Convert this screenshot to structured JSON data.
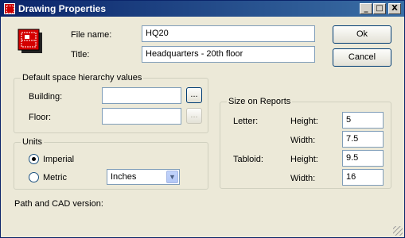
{
  "window": {
    "title": "Drawing Properties"
  },
  "titlebar_buttons": {
    "minimize": "_",
    "maximize": "□",
    "close": "X"
  },
  "file_name": {
    "label": "File name:",
    "value": "HQ20"
  },
  "title_field": {
    "label": "Title:",
    "value": "Headquarters - 20th floor"
  },
  "buttons": {
    "ok": "Ok",
    "cancel": "Cancel"
  },
  "hierarchy": {
    "group_title": "Default space hierarchy values",
    "building_label": "Building:",
    "building_value": "",
    "building_browse": "...",
    "floor_label": "Floor:",
    "floor_value": "",
    "floor_browse": "..."
  },
  "units": {
    "group_title": "Units",
    "imperial": "Imperial",
    "metric": "Metric",
    "selected": "Imperial",
    "dropdown_value": "Inches"
  },
  "size_on_reports": {
    "group_title": "Size on Reports",
    "letter": {
      "label": "Letter:",
      "height_label": "Height:",
      "height": "5",
      "width_label": "Width:",
      "width": "7.5"
    },
    "tabloid": {
      "label": "Tabloid:",
      "height_label": "Height:",
      "height": "9.5",
      "width_label": "Width:",
      "width": "16"
    }
  },
  "path_label": "Path and CAD version:"
}
